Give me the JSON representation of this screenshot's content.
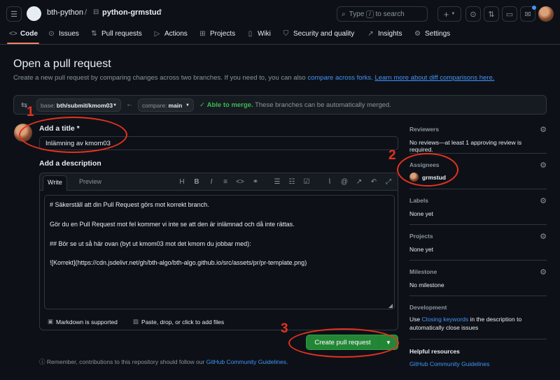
{
  "header": {
    "owner": "bth-python",
    "separator": "/",
    "repo": "python-grmstud",
    "search_prefix": "Type",
    "search_key": "/",
    "search_suffix": "to search",
    "plus_label": "+"
  },
  "tabs": [
    {
      "label": "Code",
      "icon": "code-icon"
    },
    {
      "label": "Issues",
      "icon": "issue-icon"
    },
    {
      "label": "Pull requests",
      "icon": "pull-request-icon"
    },
    {
      "label": "Actions",
      "icon": "play-icon"
    },
    {
      "label": "Projects",
      "icon": "table-icon"
    },
    {
      "label": "Wiki",
      "icon": "book-icon"
    },
    {
      "label": "Security and quality",
      "icon": "shield-icon"
    },
    {
      "label": "Insights",
      "icon": "graph-icon"
    },
    {
      "label": "Settings",
      "icon": "gear-icon"
    }
  ],
  "page": {
    "title": "Open a pull request",
    "subtitle": "Create a new pull request by comparing changes across two branches. If you need to, you can also ",
    "link_forks": "compare across forks",
    "link_diff": "Learn more about diff comparisons here."
  },
  "branches": {
    "base_label": "base:",
    "base_value": "bth/submit/kmom03",
    "compare_label": "compare:",
    "compare_value": "main",
    "merge_status": "Able to merge.",
    "merge_detail": "These branches can be automatically merged."
  },
  "form": {
    "title_label": "Add a title *",
    "title_value": "Inlämning av kmom03",
    "description_label": "Add a description",
    "tab_write": "Write",
    "tab_preview": "Preview",
    "toolbar": {
      "heading": "H",
      "bold": "B",
      "italic": "I"
    },
    "body_lines": [
      "# Säkerställ att din Pull Request görs mot korrekt branch.",
      "Gör du en Pull Request mot fel kommer vi inte se att den är inlämnad och då inte rättas.",
      "## Bör se ut så här ovan (byt ut kmom03 mot det kmom du jobbar med):",
      "![Korrekt](https://cdn.jsdelivr.net/gh/bth-algo/bth-algo.github.io/src/assets/pr/pr-template.png)"
    ],
    "markdown_note": "Markdown is supported",
    "attach_note": "Paste, drop, or click to add files",
    "create_button": "Create pull request",
    "remember_prefix": "Remember, contributions to this repository should follow our ",
    "remember_link": "GitHub Community Guidelines",
    "remember_suffix": "."
  },
  "sidebar": {
    "reviewers": {
      "title": "Reviewers",
      "value": "No reviews—at least 1 approving review is required."
    },
    "assignees": {
      "title": "Assignees",
      "value": "grmstud"
    },
    "labels": {
      "title": "Labels",
      "value": "None yet"
    },
    "projects": {
      "title": "Projects",
      "value": "None yet"
    },
    "milestone": {
      "title": "Milestone",
      "value": "No milestone"
    },
    "development": {
      "title": "Development",
      "prefix": "Use ",
      "link": "Closing keywords",
      "suffix": " in the description to automatically close issues"
    },
    "helpful": {
      "title": "Helpful resources",
      "link": "GitHub Community Guidelines"
    }
  },
  "annotations": [
    "1",
    "2",
    "3"
  ],
  "colors": {
    "accent_red": "#e5311f",
    "link_blue": "#4493f8",
    "merge_green": "#3fb950",
    "button_green": "#238636"
  }
}
